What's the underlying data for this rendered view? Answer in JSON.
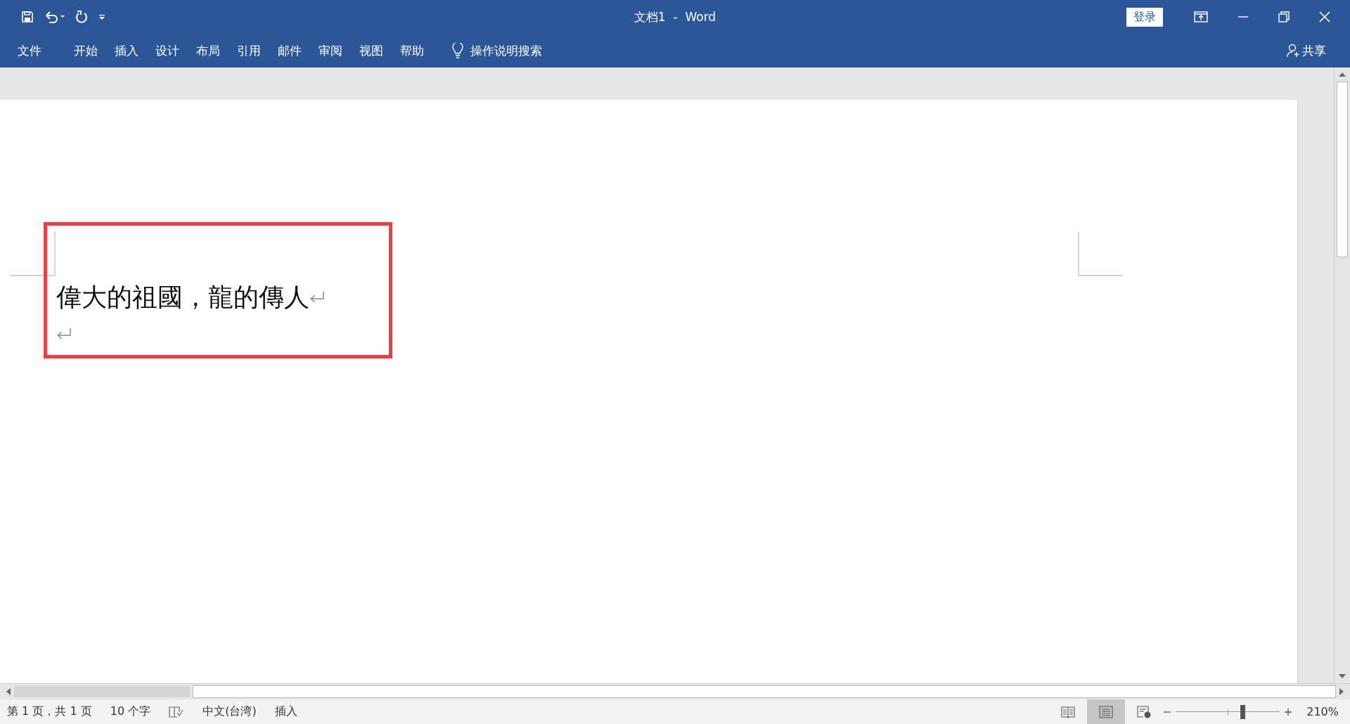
{
  "window": {
    "title": "文档1  -  Word",
    "sign_in": "登录"
  },
  "ribbon": {
    "tabs": [
      "文件",
      "开始",
      "插入",
      "设计",
      "布局",
      "引用",
      "邮件",
      "审阅",
      "视图",
      "帮助"
    ],
    "tell_me": "操作说明搜索",
    "share": "共享"
  },
  "document": {
    "paragraphs": [
      "偉大的祖國，龍的傳人"
    ]
  },
  "status_bar": {
    "page": "第 1 页，共 1 页",
    "words": "10 个字",
    "language": "中文(台湾)",
    "mode": "插入",
    "views": [
      {
        "kind": "read",
        "selected": false
      },
      {
        "kind": "print",
        "selected": true
      },
      {
        "kind": "web",
        "selected": false
      }
    ],
    "zoom": {
      "level": 0.64,
      "reading": "210%"
    }
  }
}
